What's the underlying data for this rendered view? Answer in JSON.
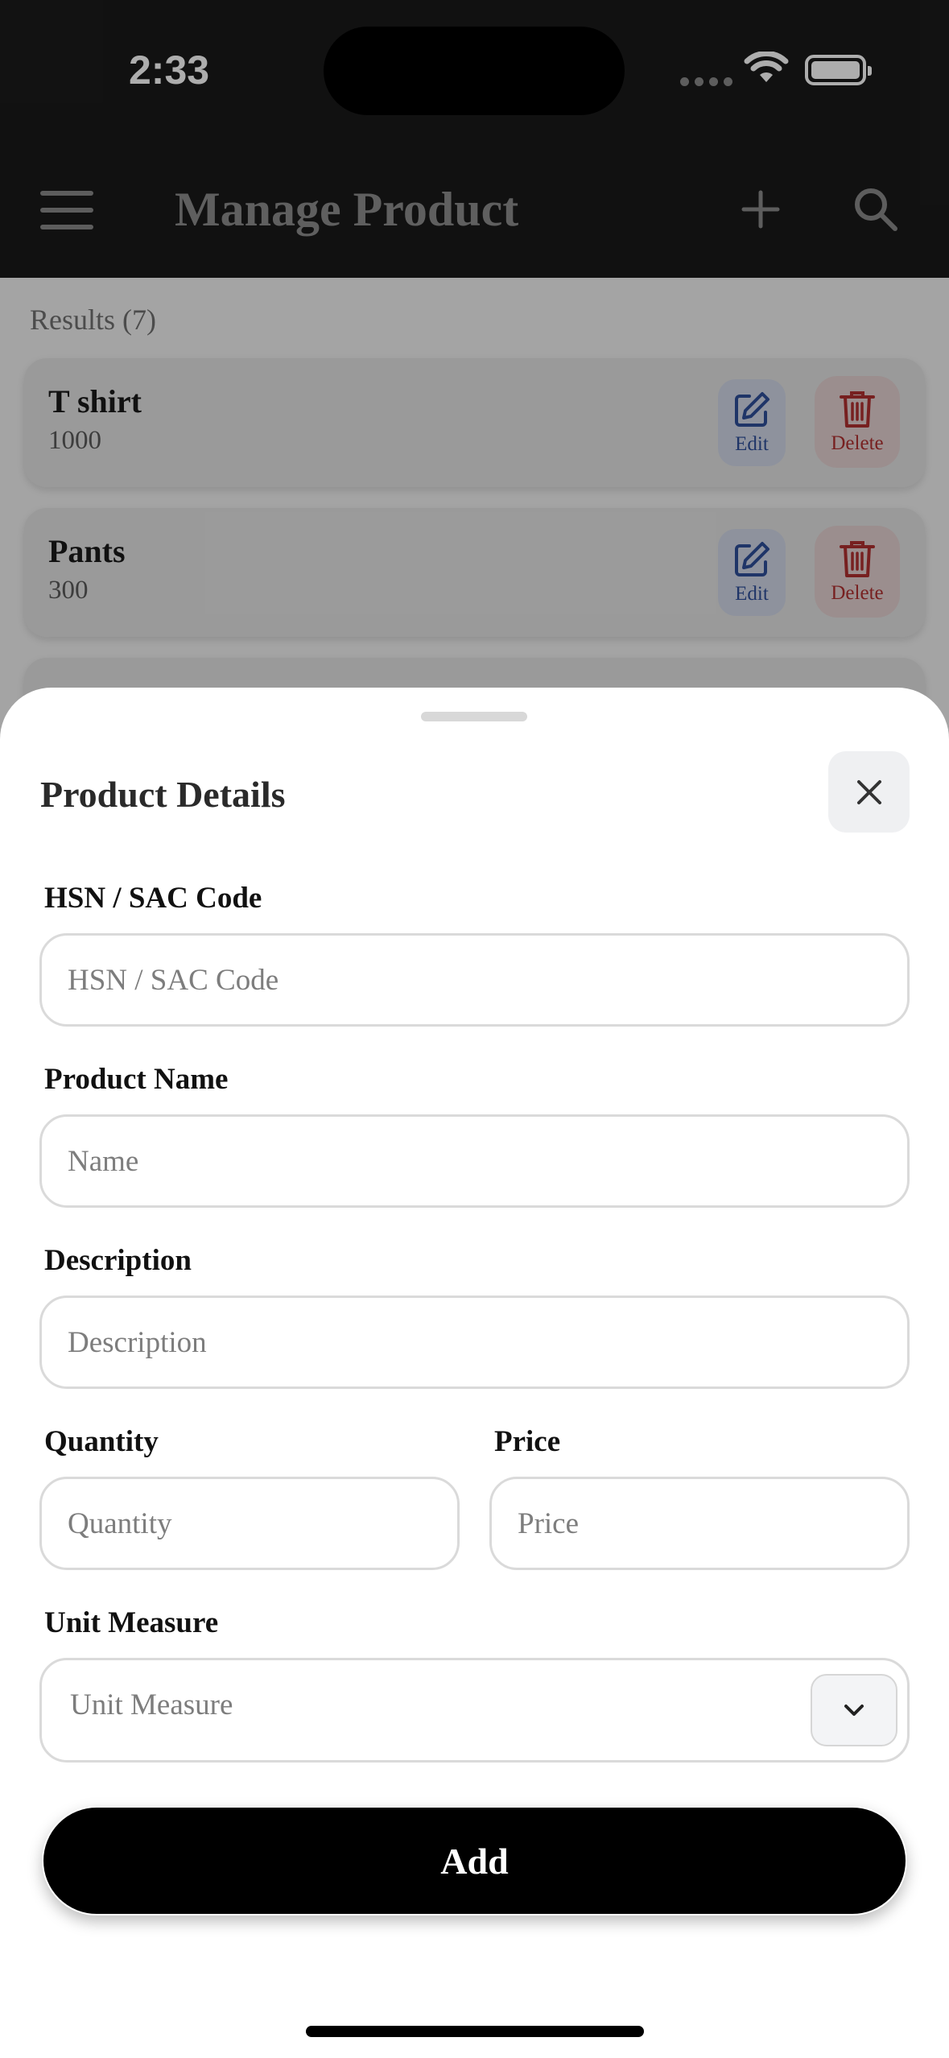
{
  "status_bar": {
    "time": "2:33"
  },
  "header": {
    "title": "Manage Product",
    "icons": {
      "menu": "hamburger-menu-icon",
      "add": "plus-icon",
      "search": "search-icon"
    }
  },
  "list": {
    "results_label": "Results (7)",
    "items": [
      {
        "name": "T shirt",
        "value": "1000",
        "edit_label": "Edit",
        "delete_label": "Delete"
      },
      {
        "name": "Pants",
        "value": "300",
        "edit_label": "Edit",
        "delete_label": "Delete"
      }
    ]
  },
  "sheet": {
    "title": "Product Details",
    "fields": {
      "hsn": {
        "label": "HSN / SAC Code",
        "placeholder": "HSN / SAC Code",
        "value": ""
      },
      "name": {
        "label": "Product Name",
        "placeholder": "Name",
        "value": ""
      },
      "description": {
        "label": "Description",
        "placeholder": "Description",
        "value": ""
      },
      "quantity": {
        "label": "Quantity",
        "placeholder": "Quantity",
        "value": ""
      },
      "price": {
        "label": "Price",
        "placeholder": "Price",
        "value": ""
      },
      "unit": {
        "label": "Unit Measure",
        "placeholder": "Unit Measure"
      }
    },
    "submit_label": "Add"
  },
  "colors": {
    "header_bg": "#1a1a1a",
    "edit_accent": "#2f4f9a",
    "delete_accent": "#b03030",
    "primary_button": "#000000"
  }
}
